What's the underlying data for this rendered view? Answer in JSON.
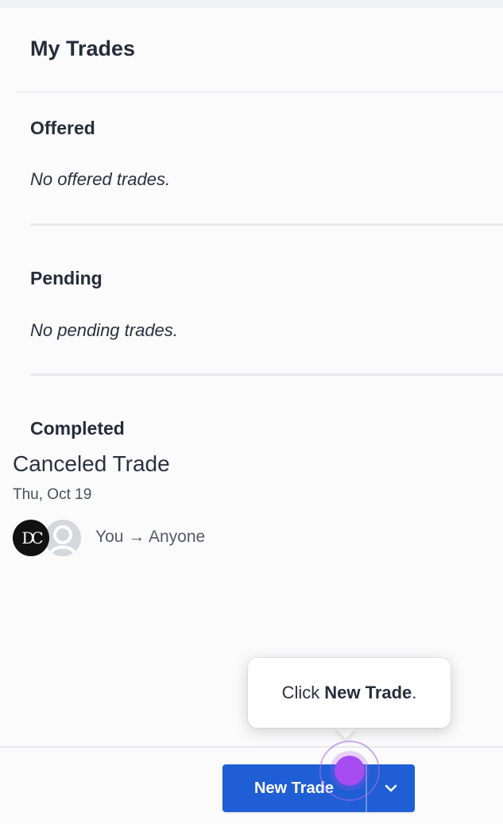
{
  "header": {
    "title": "My Trades"
  },
  "sections": {
    "offered": {
      "title": "Offered",
      "empty": "No offered trades."
    },
    "pending": {
      "title": "Pending",
      "empty": "No pending trades."
    },
    "completed": {
      "title": "Completed",
      "trade": {
        "title": "Canceled Trade",
        "date": "Thu, Oct 19",
        "avatar_initials": "DC",
        "avatar_icon": "user-placeholder-icon",
        "parties": "You → Anyone"
      }
    }
  },
  "actions": {
    "new_trade_label": "New Trade",
    "dropdown_icon": "chevron-down-icon"
  },
  "tooltip": {
    "prefix": "Click",
    "bold": "New Trade",
    "suffix": "."
  },
  "colors": {
    "primary": "#1f5ed4",
    "highlight": "#a64cf0"
  }
}
